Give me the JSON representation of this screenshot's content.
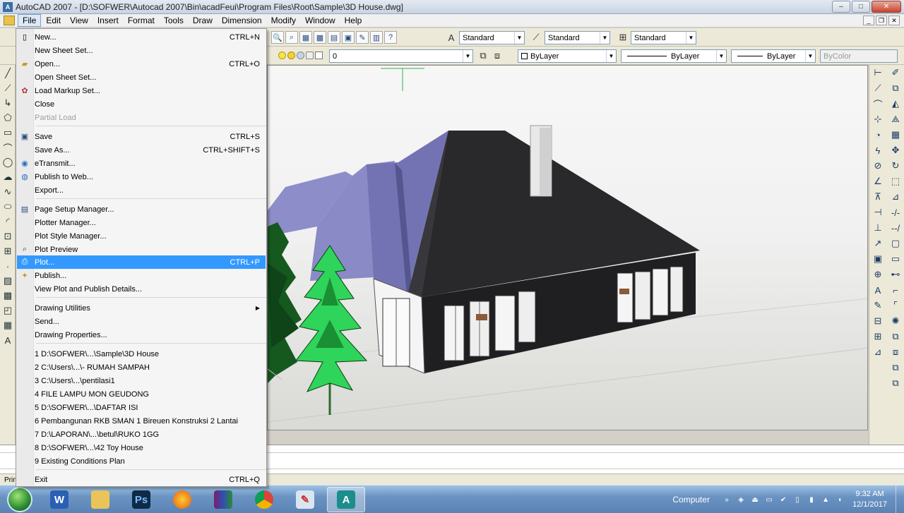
{
  "window": {
    "title": "AutoCAD 2007 - [D:\\SOFWER\\Autocad 2007\\Bin\\acadFeui\\Program Files\\Root\\Sample\\3D House.dwg]",
    "app_icon": "A",
    "minimize": "–",
    "maximize": "□",
    "close": "✕"
  },
  "menubar": {
    "items": [
      "File",
      "Edit",
      "View",
      "Insert",
      "Format",
      "Tools",
      "Draw",
      "Dimension",
      "Modify",
      "Window",
      "Help"
    ],
    "mdi_minimize": "_",
    "mdi_restore": "❐",
    "mdi_close": "✕"
  },
  "toolbar_row1": {
    "text_style": "Standard",
    "dim_style": "Standard",
    "table_style": "Standard"
  },
  "toolbar_row2": {
    "layer": "0",
    "color": "ByLayer",
    "linetype": "ByLayer",
    "lineweight": "ByLayer",
    "plot_style": "ByColor"
  },
  "file_menu": {
    "items": [
      {
        "label": "New...",
        "shortcut": "CTRL+N",
        "icon": "new-icon"
      },
      {
        "label": "New Sheet Set...",
        "shortcut": ""
      },
      {
        "label": "Open...",
        "shortcut": "CTRL+O",
        "icon": "open-icon"
      },
      {
        "label": "Open Sheet Set...",
        "shortcut": ""
      },
      {
        "label": "Load Markup Set...",
        "shortcut": "",
        "icon": "markup-icon"
      },
      {
        "label": "Close",
        "shortcut": ""
      },
      {
        "label": "Partial Load",
        "shortcut": "",
        "disabled": true
      },
      {
        "label": "Save",
        "shortcut": "CTRL+S",
        "icon": "save-icon"
      },
      {
        "label": "Save As...",
        "shortcut": "CTRL+SHIFT+S"
      },
      {
        "label": "eTransmit...",
        "shortcut": "",
        "icon": "etransmit-icon"
      },
      {
        "label": "Publish to Web...",
        "shortcut": "",
        "icon": "web-icon"
      },
      {
        "label": "Export...",
        "shortcut": ""
      },
      {
        "label": "Page Setup Manager...",
        "shortcut": "",
        "icon": "page-setup-icon"
      },
      {
        "label": "Plotter Manager...",
        "shortcut": ""
      },
      {
        "label": "Plot Style Manager...",
        "shortcut": ""
      },
      {
        "label": "Plot Preview",
        "shortcut": "",
        "icon": "plot-preview-icon"
      },
      {
        "label": "Plot...",
        "shortcut": "CTRL+P",
        "icon": "plot-icon"
      },
      {
        "label": "Publish...",
        "shortcut": "",
        "icon": "publish-icon"
      },
      {
        "label": "View Plot and Publish Details...",
        "shortcut": ""
      },
      {
        "label": "Drawing Utilities",
        "shortcut": "",
        "submenu": true
      },
      {
        "label": "Send...",
        "shortcut": ""
      },
      {
        "label": "Drawing Properties...",
        "shortcut": ""
      },
      {
        "label": "1 D:\\SOFWER\\...\\Sample\\3D House",
        "shortcut": ""
      },
      {
        "label": "2 C:\\Users\\...\\- RUMAH SAMPAH",
        "shortcut": ""
      },
      {
        "label": "3 C:\\Users\\...\\pentilasi1",
        "shortcut": ""
      },
      {
        "label": "4 FILE LAMPU MON GEUDONG",
        "shortcut": ""
      },
      {
        "label": "5 D:\\SOFWER\\...\\DAFTAR ISI",
        "shortcut": ""
      },
      {
        "label": "6 Pembangunan RKB SMAN 1 Bireuen Konstruksi 2 Lantai",
        "shortcut": ""
      },
      {
        "label": "7 D:\\LAPORAN\\...\\betul\\RUKO 1GG",
        "shortcut": ""
      },
      {
        "label": "8 D:\\SOFWER\\...\\42 Toy House",
        "shortcut": ""
      },
      {
        "label": "9 Existing Conditions Plan",
        "shortcut": ""
      },
      {
        "label": "Exit",
        "shortcut": "CTRL+Q"
      }
    ]
  },
  "status": {
    "left_text": "Prin"
  },
  "taskbar": {
    "computer_label": "Computer",
    "time": "9:32 AM",
    "date": "12/1/2017",
    "apps": [
      "word",
      "explorer",
      "photoshop",
      "firefox",
      "winrar",
      "chrome",
      "paint",
      "autocad"
    ]
  },
  "colors": {
    "menu_highlight": "#3399ff",
    "roof": "#2b2b2e",
    "roof_side": "#7c7cb8",
    "tree_light": "#2fd45a",
    "tree_dark": "#15591f"
  }
}
